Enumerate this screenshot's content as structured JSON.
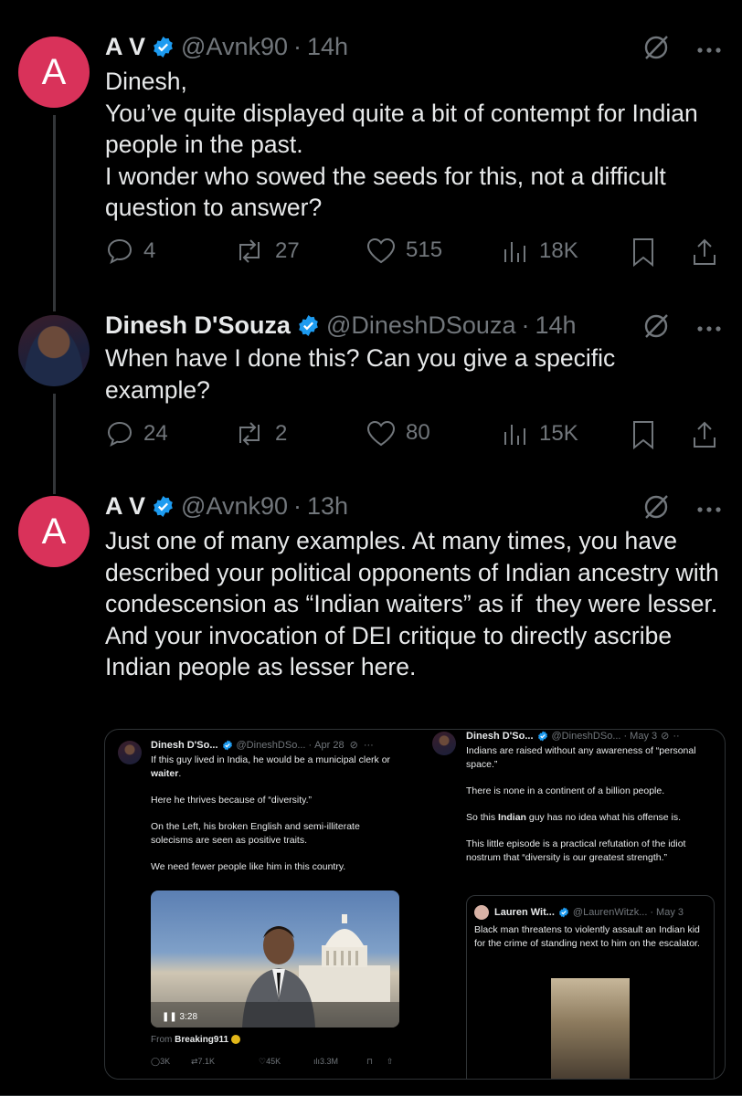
{
  "tweets": [
    {
      "avatar_letter": "A",
      "name": "A V",
      "handle": "@Avnk90",
      "time": "14h",
      "text": "Dinesh,\nYou’ve quite displayed quite a bit of contempt for Indian people in the past.\nI wonder who sowed the seeds for this, not a difficult question to answer?",
      "replies": "4",
      "reposts": "27",
      "likes": "515",
      "views": "18K"
    },
    {
      "name": "Dinesh D'Souza",
      "handle": "@DineshDSouza",
      "time": "14h",
      "text": "When have I done this? Can you give a specific example?",
      "replies": "24",
      "reposts": "2",
      "likes": "80",
      "views": "15K"
    },
    {
      "avatar_letter": "A",
      "name": "A V",
      "handle": "@Avnk90",
      "time": "13h",
      "text": "Just one of many examples. At many times, you have described your political opponents of Indian ancestry with condescension as “Indian waiters” as if  they were lesser.\nAnd your invocation of DEI critique to directly ascribe Indian people as lesser here."
    }
  ],
  "embed": {
    "left": {
      "name": "Dinesh D'So...",
      "handle": "@DineshDSo...",
      "time": "Apr 28",
      "line1": "If this guy lived in India, he would be a municipal clerk or ",
      "line1_bold": "waiter",
      "line1_end": ".",
      "p2": "Here he thrives because of “diversity.”",
      "p3": "On the Left, his broken English and semi-illiterate solecisms are seen as  positive traits.",
      "p4": "We need fewer people like him in this country.",
      "duration": "3:28",
      "from_label": "From",
      "from_source": "Breaking911",
      "replies": "3K",
      "reposts": "7.1K",
      "likes": "45K",
      "views": "3.3M"
    },
    "right": {
      "name": "Dinesh D'So...",
      "handle": "@DineshDSo...",
      "time": "May 3",
      "p1": "Indians are raised without any awareness of “personal space.”",
      "p2": "There is none in a continent of a billion people.",
      "p3_start": "So this ",
      "p3_bold": "Indian",
      "p3_end": " guy has no idea what his offense is.",
      "p4": "This little episode is a practical refutation of the idiot nostrum that  “diversity is our greatest strength.”",
      "quote": {
        "name": "Lauren Wit...",
        "handle": "@LaurenWitzk...",
        "time": "May 3",
        "text": "Black man threatens to violently assault an Indian kid for the crime of standing next to him on the escalator."
      }
    }
  },
  "colors": {
    "avatar_bg": "#d9325a",
    "verified": "#1d9bf0",
    "muted": "#71767b",
    "text": "#e7e9ea"
  }
}
